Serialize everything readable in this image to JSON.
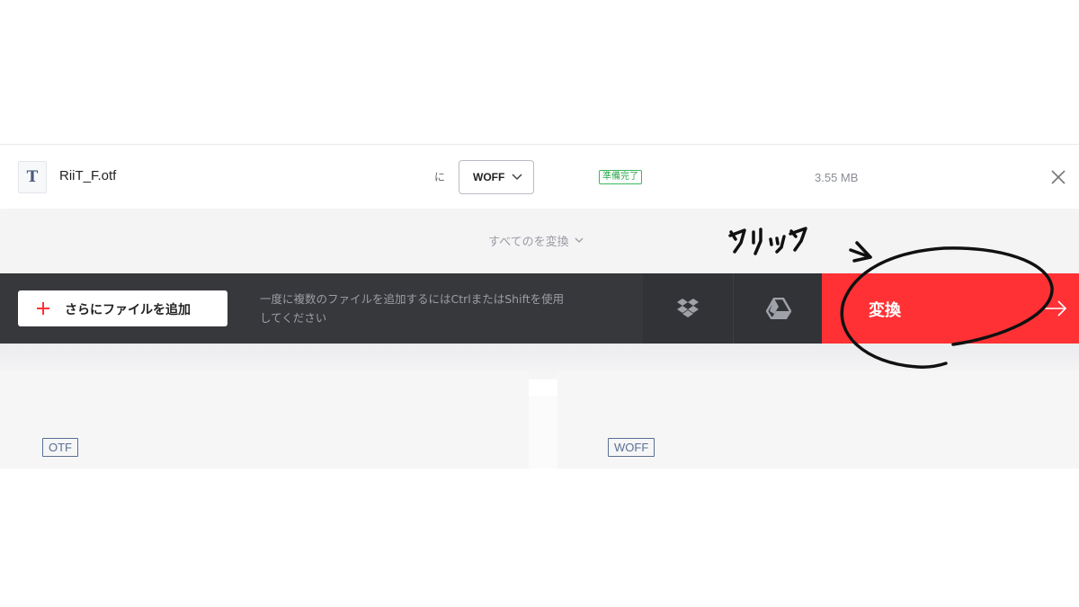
{
  "file": {
    "icon_letter": "T",
    "name": "RiiT_F.otf",
    "to_label": "に",
    "target_format": "WOFF",
    "status": "準備完了",
    "size": "3.55 MB"
  },
  "convert_all": {
    "label": "すべてのを変換"
  },
  "action_bar": {
    "add_files_label": "さらにファイルを追加",
    "hint_line1": "一度に複数のファイルを追加するにはCtrlまたはShiftを使用",
    "hint_line2": "してください",
    "convert_label": "変換"
  },
  "panels": {
    "source_format": "OTF",
    "target_format": "WOFF"
  },
  "annotation": {
    "text": "クリック"
  },
  "colors": {
    "convert_red": "#ff3135",
    "action_bar_bg": "#37383c",
    "status_green": "#3bb85d",
    "tag_blue": "#5b6f95"
  },
  "icons": [
    "font-file-icon",
    "chevron-down-icon",
    "close-icon",
    "plus-icon",
    "dropbox-icon",
    "google-drive-icon",
    "arrow-right-icon"
  ]
}
